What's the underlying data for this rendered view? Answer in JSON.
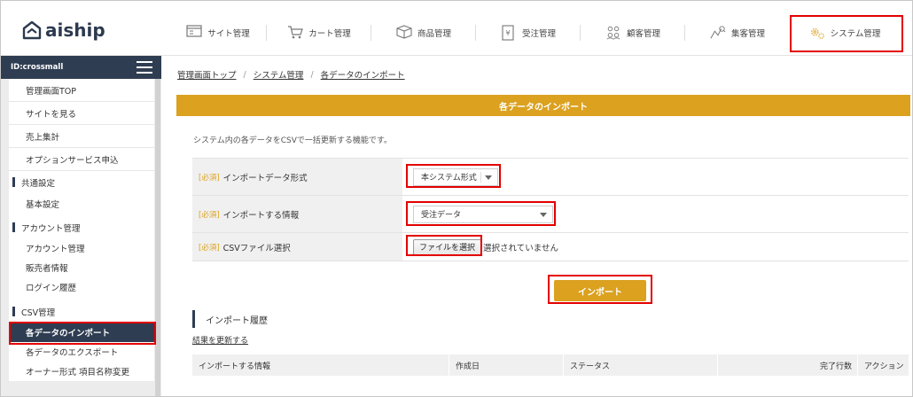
{
  "header": {
    "logo_text": "aiship",
    "nav": [
      {
        "label": "サイト管理",
        "icon": "site-window-icon"
      },
      {
        "label": "カート管理",
        "icon": "cart-icon"
      },
      {
        "label": "商品管理",
        "icon": "box-icon"
      },
      {
        "label": "受注管理",
        "icon": "yen-document-icon"
      },
      {
        "label": "顧客管理",
        "icon": "people-icon"
      },
      {
        "label": "集客管理",
        "icon": "chart-search-icon"
      },
      {
        "label": "システム管理",
        "icon": "gears-icon"
      }
    ]
  },
  "sidebar": {
    "account_id": "ID:crossmall",
    "items": [
      {
        "label": "管理画面TOP"
      },
      {
        "label": "サイトを見る"
      },
      {
        "label": "売上集計"
      },
      {
        "label": "オプションサービス申込"
      }
    ],
    "sections": [
      {
        "title": "共通設定",
        "items": [
          "基本設定"
        ]
      },
      {
        "title": "アカウント管理",
        "items": [
          "アカウント管理",
          "販売者情報",
          "ログイン履歴"
        ]
      },
      {
        "title": "CSV管理",
        "items": [
          "各データのインポート",
          "各データのエクスポート",
          "オーナー形式 項目名称変更"
        ]
      }
    ]
  },
  "breadcrumb": [
    "管理画面トップ",
    "システム管理",
    "各データのインポート"
  ],
  "page": {
    "title": "各データのインポート",
    "description": "システム内の各データをCSVで一括更新する機能です。",
    "required_tag": "[必須]",
    "fields": {
      "format_label": "インポートデータ形式",
      "format_value": "本システム形式",
      "info_label": "インポートする情報",
      "info_value": "受注データ",
      "csv_label": "CSVファイル選択",
      "file_button": "ファイルを選択",
      "file_status": "選択されていません"
    },
    "import_button": "インポート",
    "history_title": "インポート履歴",
    "refresh_link": "結果を更新する",
    "table_headers": [
      "インポートする情報",
      "作成日",
      "ステータス",
      "完了行数",
      "アクション"
    ]
  }
}
